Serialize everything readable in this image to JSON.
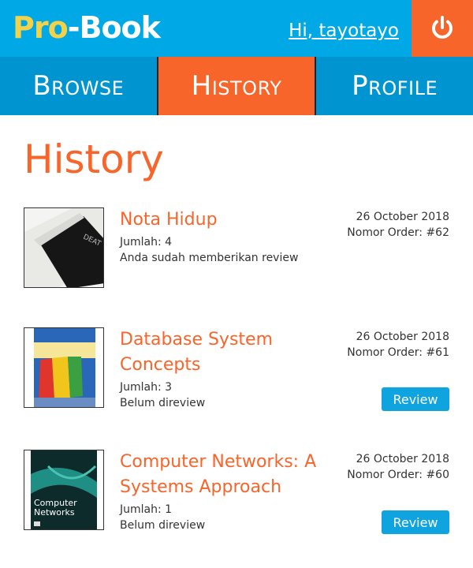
{
  "header": {
    "logo_pro": "Pro",
    "logo_dash": "-",
    "logo_book": "Book",
    "greeting": "Hi, tayotayo",
    "logout_icon": "power-icon"
  },
  "nav": {
    "browse": "Browse",
    "history": "History",
    "profile": "Profile",
    "active": "history"
  },
  "page": {
    "title": "History"
  },
  "orders": [
    {
      "title": "Nota Hidup",
      "quantity": "Jumlah: 4",
      "status": "Anda sudah memberikan review",
      "date": "26 October 2018",
      "order_no": "Nomor Order: #62",
      "review_label": ""
    },
    {
      "title": "Database System Concepts",
      "quantity": "Jumlah: 3",
      "status": "Belum direview",
      "date": "26 October 2018",
      "order_no": "Nomor Order: #61",
      "review_label": "Review"
    },
    {
      "title": "Computer Networks: A Systems Approach",
      "quantity": "Jumlah: 1",
      "status": "Belum direview",
      "date": "26 October 2018",
      "order_no": "Nomor Order: #60",
      "review_label": "Review"
    }
  ],
  "colors": {
    "header_blue": "#00a9e6",
    "nav_blue": "#0095d0",
    "accent_orange": "#f7652a",
    "logo_yellow": "#f2d24b",
    "button_blue": "#0fa4e0"
  }
}
